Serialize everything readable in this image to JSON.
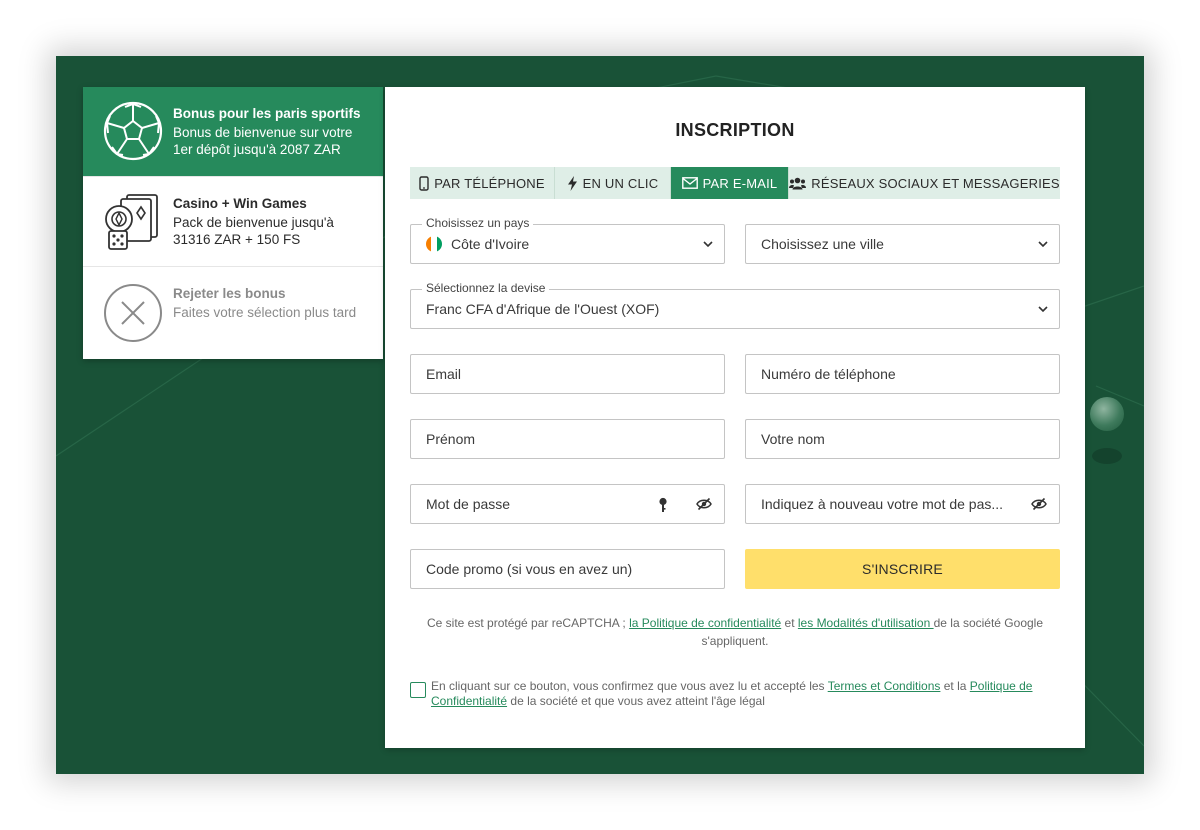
{
  "bonus": {
    "items": [
      {
        "title": "Bonus pour les paris sportifs",
        "desc": "Bonus de bienvenue sur votre 1er dépôt jusqu'à 2087 ZAR",
        "icon": "soccer-ball-icon"
      },
      {
        "title": "Casino + Win Games",
        "desc": "Pack de bienvenue jusqu'à 31316 ZAR + 150 FS",
        "icon": "casino-icon"
      },
      {
        "title": "Rejeter les bonus",
        "desc": "Faites votre sélection plus tard",
        "icon": "close-circle-icon"
      }
    ]
  },
  "form": {
    "title": "INSCRIPTION",
    "tabs": [
      {
        "label": "PAR TÉLÉPHONE",
        "icon": "phone-icon"
      },
      {
        "label": "EN UN CLIC",
        "icon": "lightning-icon"
      },
      {
        "label": "PAR E-MAIL",
        "icon": "envelope-icon",
        "active": true
      },
      {
        "label": "RÉSEAUX SOCIAUX ET MESSAGERIES",
        "icon": "users-icon"
      }
    ],
    "country": {
      "legend": "Choisissez un pays",
      "value": "Côte d'Ivoire"
    },
    "city": {
      "value": "Choisissez une ville"
    },
    "currency": {
      "legend": "Sélectionnez la devise",
      "value": "Franc CFA d'Afrique de l'Ouest (XOF)"
    },
    "email": {
      "placeholder": "Email"
    },
    "phone": {
      "placeholder": "Numéro de téléphone"
    },
    "first_name": {
      "placeholder": "Prénom"
    },
    "last_name": {
      "placeholder": "Votre nom"
    },
    "password": {
      "placeholder": "Mot de passe"
    },
    "password_repeat": {
      "placeholder": "Indiquez à nouveau votre mot de pas..."
    },
    "promo": {
      "placeholder": "Code promo (si vous en avez un)"
    },
    "submit_label": "S'INSCRIRE",
    "recaptcha": {
      "prefix": "Ce site est protégé par reCAPTCHA ; ",
      "privacy_link": "la Politique de confidentialité",
      "and": " et ",
      "terms_link": "les Modalités d'utilisation ",
      "suffix": "de la société Google s'appliquent."
    },
    "consent": {
      "prefix": "En cliquant sur ce bouton, vous confirmez que vous avez lu et accepté les ",
      "terms_link": "Termes et Conditions",
      "and": " et la ",
      "privacy_link": "Politique de Confidentialité",
      "suffix": " de la société et que vous avez atteint l'âge légal"
    }
  },
  "colors": {
    "background_green": "#195237",
    "brand_green": "#268a5c",
    "tab_inactive": "#dfeee7",
    "submit_yellow": "#ffdf6b",
    "flag_orange": "#f77f00",
    "flag_white": "#ffffff",
    "flag_green": "#009e60"
  }
}
